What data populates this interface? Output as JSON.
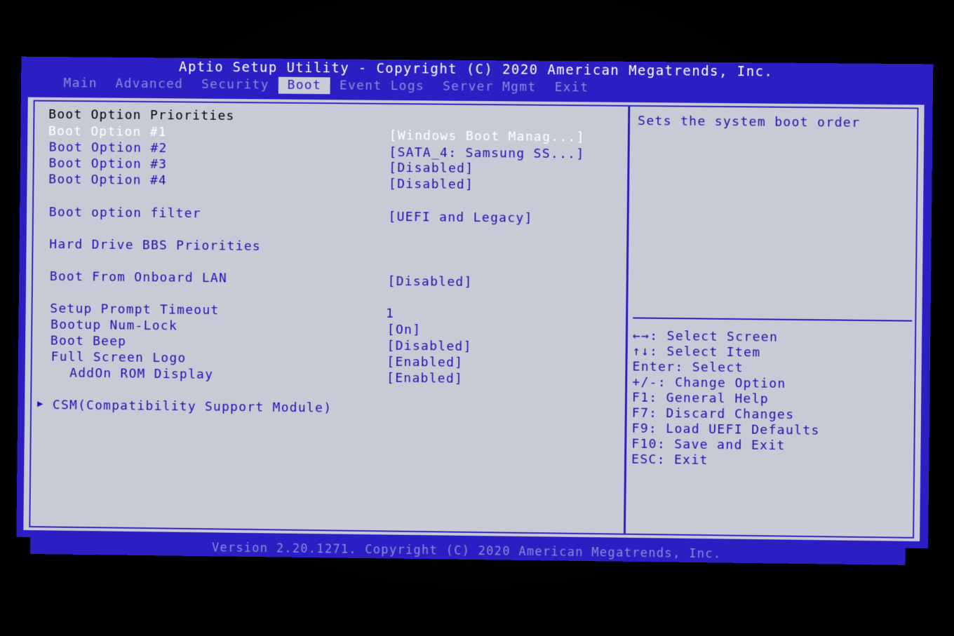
{
  "header": {
    "title": "Aptio Setup Utility - Copyright (C) 2020 American Megatrends, Inc.",
    "tabs": [
      {
        "label": "Main",
        "active": false
      },
      {
        "label": "Advanced",
        "active": false
      },
      {
        "label": "Security",
        "active": false
      },
      {
        "label": "Boot",
        "active": true
      },
      {
        "label": "Event Logs",
        "active": false
      },
      {
        "label": "Server Mgmt",
        "active": false
      },
      {
        "label": "Exit",
        "active": false
      }
    ]
  },
  "boot": {
    "priorities_heading": "Boot Option Priorities",
    "option1": {
      "label": "Boot Option #1",
      "value": "[Windows Boot Manag...]"
    },
    "option2": {
      "label": "Boot Option #2",
      "value": "[SATA_4: Samsung SS...]"
    },
    "option3": {
      "label": "Boot Option #3",
      "value": "[Disabled]"
    },
    "option4": {
      "label": "Boot Option #4",
      "value": "[Disabled]"
    },
    "filter": {
      "label": "Boot option filter",
      "value": "[UEFI and Legacy]"
    },
    "hdd_bbs": {
      "label": "Hard Drive BBS Priorities"
    },
    "onboard_lan": {
      "label": "Boot From Onboard LAN",
      "value": "[Disabled]"
    },
    "prompt_timeout": {
      "label": "Setup Prompt Timeout",
      "value": "1"
    },
    "numlock": {
      "label": "Bootup Num-Lock",
      "value": "[On]"
    },
    "beep": {
      "label": "Boot Beep",
      "value": "[Disabled]"
    },
    "full_logo": {
      "label": "Full Screen Logo",
      "value": "[Enabled]"
    },
    "addon_rom": {
      "label": "AddOn ROM Display",
      "value": "[Enabled]"
    },
    "csm": {
      "label": "CSM(Compatibility Support Module)"
    }
  },
  "help": {
    "description": "Sets the system boot order",
    "keys": [
      "←→: Select Screen",
      "↑↓: Select Item",
      "Enter: Select",
      "+/-: Change Option",
      "F1: General Help",
      "F7: Discard Changes",
      "F9: Load UEFI Defaults",
      "F10: Save and Exit",
      "ESC: Exit"
    ]
  },
  "footer": {
    "text": "Version 2.20.1271. Copyright (C) 2020 American Megatrends, Inc."
  },
  "colors": {
    "frame_blue": "#2b1fc4",
    "panel_grey": "#c8cad6",
    "text_blue": "#1c14b0",
    "dim_text": "#8f8ad8",
    "selected_text": "#ffffff"
  }
}
